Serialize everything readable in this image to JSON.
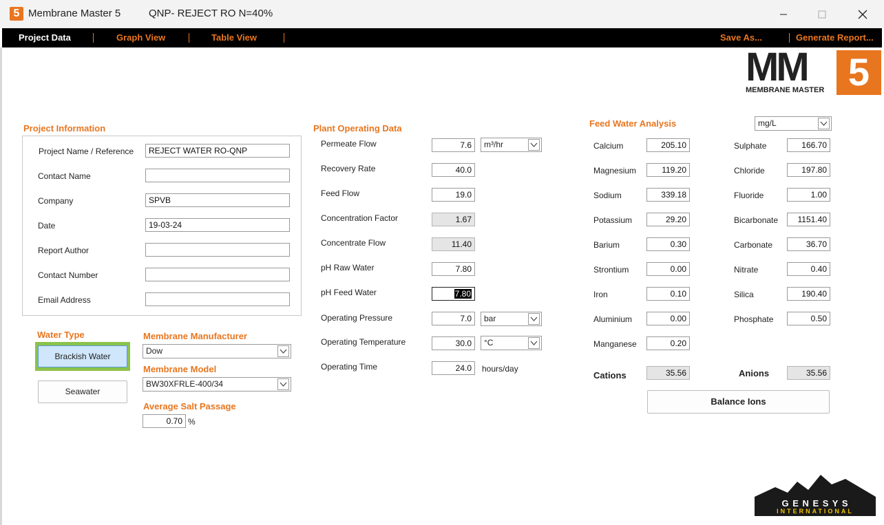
{
  "window": {
    "app_title": "Membrane Master 5",
    "app_logo_text": "5",
    "doc_title": "QNP- REJECT RO N=40%",
    "minimize_glyph": "—",
    "maximize_glyph": "☐",
    "close_glyph": "✕"
  },
  "menu": {
    "project_data": "Project Data",
    "graph_view": "Graph View",
    "table_view": "Table View",
    "save_as": "Save As...",
    "generate_report": "Generate Report..."
  },
  "brand": {
    "logo_mm": "MM",
    "logo_5": "5",
    "logo_sub": "MEMBRANE MASTER",
    "genesys_1": "G E N E S Y S",
    "genesys_2": "INTERNATIONAL"
  },
  "project_info": {
    "heading": "Project Information",
    "fields": [
      {
        "label": "Project Name / Reference",
        "value": "REJECT WATER RO-QNP"
      },
      {
        "label": "Contact Name",
        "value": ""
      },
      {
        "label": "Company",
        "value": "SPVB"
      },
      {
        "label": "Date",
        "value": "19-03-24"
      },
      {
        "label": "Report Author",
        "value": ""
      },
      {
        "label": "Contact Number",
        "value": ""
      },
      {
        "label": "Email Address",
        "value": ""
      }
    ]
  },
  "water_type": {
    "heading": "Water Type",
    "brackish": "Brackish Water",
    "seawater": "Seawater"
  },
  "membrane": {
    "manufacturer_heading": "Membrane Manufacturer",
    "manufacturer_value": "Dow",
    "model_heading": "Membrane Model",
    "model_value": "BW30XFRLE-400/34",
    "salt_heading": "Average Salt Passage",
    "salt_value": "0.70",
    "salt_unit": "%"
  },
  "plant": {
    "heading": "Plant Operating Data",
    "permeate_flow": {
      "label": "Permeate Flow",
      "value": "7.6",
      "unit": "m³/hr"
    },
    "recovery_rate": {
      "label": "Recovery Rate",
      "value": "40.0"
    },
    "feed_flow": {
      "label": "Feed Flow",
      "value": "19.0"
    },
    "concentration_factor": {
      "label": "Concentration Factor",
      "value": "1.67"
    },
    "concentrate_flow": {
      "label": "Concentrate Flow",
      "value": "11.40"
    },
    "ph_raw": {
      "label": "pH Raw Water",
      "value": "7.80"
    },
    "ph_feed": {
      "label": "pH Feed Water",
      "value": "7.80"
    },
    "pressure": {
      "label": "Operating Pressure",
      "value": "7.0",
      "unit": "bar"
    },
    "temperature": {
      "label": "Operating Temperature",
      "value": "30.0",
      "unit": "°C"
    },
    "time": {
      "label": "Operating Time",
      "value": "24.0",
      "unit": "hours/day"
    }
  },
  "feed": {
    "heading": "Feed Water Analysis",
    "units": "mg/L",
    "cations": [
      {
        "label": "Calcium",
        "value": "205.10"
      },
      {
        "label": "Magnesium",
        "value": "119.20"
      },
      {
        "label": "Sodium",
        "value": "339.18"
      },
      {
        "label": "Potassium",
        "value": "29.20"
      },
      {
        "label": "Barium",
        "value": "0.30"
      },
      {
        "label": "Strontium",
        "value": "0.00"
      },
      {
        "label": "Iron",
        "value": "0.10"
      },
      {
        "label": "Aluminium",
        "value": "0.00"
      },
      {
        "label": "Manganese",
        "value": "0.20"
      }
    ],
    "anions": [
      {
        "label": "Sulphate",
        "value": "166.70"
      },
      {
        "label": "Chloride",
        "value": "197.80"
      },
      {
        "label": "Fluoride",
        "value": "1.00"
      },
      {
        "label": "Bicarbonate",
        "value": "1151.40"
      },
      {
        "label": "Carbonate",
        "value": "36.70"
      },
      {
        "label": "Nitrate",
        "value": "0.40"
      },
      {
        "label": "Silica",
        "value": "190.40"
      },
      {
        "label": "Phosphate",
        "value": "0.50"
      }
    ],
    "cations_label": "Cations",
    "cations_total": "35.56",
    "anions_label": "Anions",
    "anions_total": "35.56",
    "balance_button": "Balance Ions"
  },
  "colors": {
    "accent": "#e8761f",
    "menubar": "#000000",
    "selected_button": "#cfe6fb",
    "selected_border": "#8bc34a"
  }
}
